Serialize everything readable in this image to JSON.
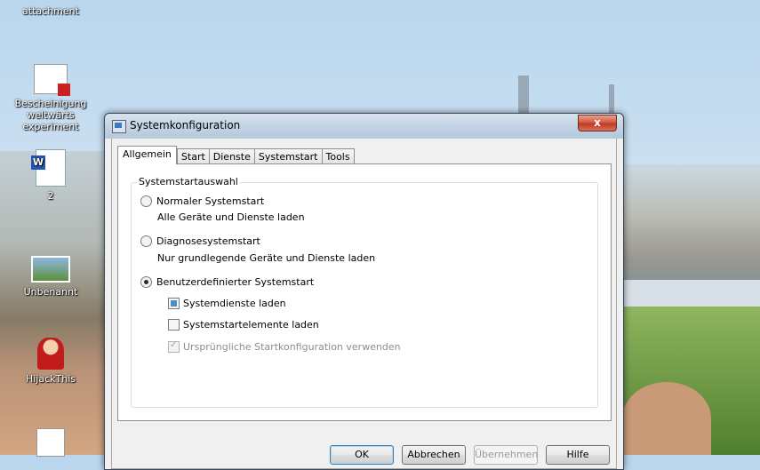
{
  "desktop": {
    "icons": [
      {
        "label": "attachment"
      },
      {
        "label": "Bescheinigung weltwärts experiment"
      },
      {
        "label": "2"
      },
      {
        "label": "Unbenannt"
      },
      {
        "label": "HijackThis"
      },
      {
        "label": ""
      }
    ]
  },
  "window": {
    "title": "Systemkonfiguration",
    "close_label": "x"
  },
  "tabs": [
    {
      "label": "Allgemein",
      "active": true
    },
    {
      "label": "Start"
    },
    {
      "label": "Dienste"
    },
    {
      "label": "Systemstart"
    },
    {
      "label": "Tools"
    }
  ],
  "group": {
    "title": "Systemstartauswahl",
    "options": [
      {
        "label": "Normaler Systemstart",
        "description": "Alle Geräte und Dienste laden",
        "selected": false
      },
      {
        "label": "Diagnosesystemstart",
        "description": "Nur grundlegende Geräte und Dienste laden",
        "selected": false
      },
      {
        "label": "Benutzerdefinierter Systemstart",
        "description": "",
        "selected": true
      }
    ],
    "checkboxes": [
      {
        "label": "Systemdienste laden",
        "state": "indeterminate",
        "enabled": true
      },
      {
        "label": "Systemstartelemente laden",
        "state": "unchecked",
        "enabled": true
      },
      {
        "label": "Ursprüngliche Startkonfiguration verwenden",
        "state": "checked",
        "enabled": false
      }
    ]
  },
  "buttons": {
    "ok": "OK",
    "cancel": "Abbrechen",
    "apply": "Übernehmen",
    "help": "Hilfe"
  }
}
